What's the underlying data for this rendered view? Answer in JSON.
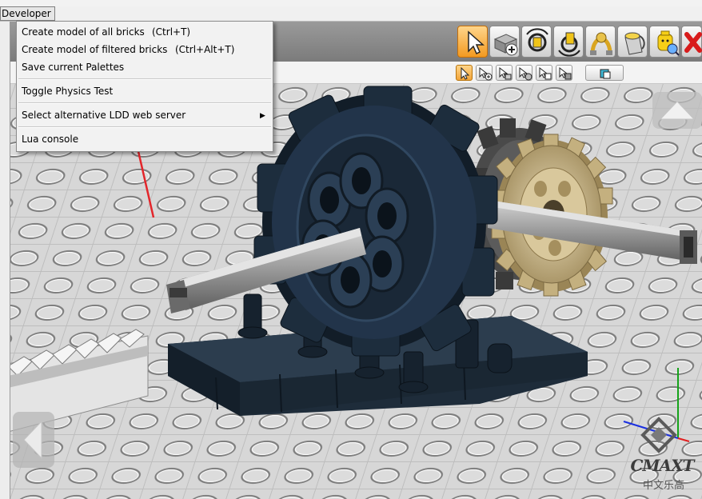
{
  "menubar": {
    "developer_label": "Developer"
  },
  "dropdown": {
    "items": [
      {
        "label": "Create model of all bricks",
        "shortcut": "(Ctrl+T)"
      },
      {
        "label": "Create model of filtered bricks",
        "shortcut": "(Ctrl+Alt+T)"
      },
      {
        "label": "Save current Palettes",
        "shortcut": ""
      },
      {
        "label": "Toggle Physics Test",
        "shortcut": ""
      },
      {
        "label": "Select alternative LDD web server",
        "shortcut": ""
      },
      {
        "label": "Lua console",
        "shortcut": ""
      }
    ]
  },
  "toolbar": {
    "tools": [
      "select-tool",
      "clone-tool",
      "hinge-tool",
      "hinge-align-tool",
      "flex-tool",
      "paint-tool",
      "decoration-tool",
      "delete-tool"
    ],
    "active_tool": "select-tool",
    "subtools": [
      "single-select",
      "multi-select",
      "connected-select",
      "same-color-select",
      "same-shape-select",
      "same-color-shape-select",
      "invert-select"
    ]
  },
  "watermark": {
    "latin": "CMAXT",
    "cjk": "中文乐高"
  },
  "colors": {
    "annotation_arrow": "#e3262b",
    "active_tool": "#f29a21",
    "gear_dark": "#1b2a38",
    "gear_tan": "#c9b68a",
    "axle_grey": "#9c9c9c",
    "baseplate": "#d6d6d6"
  }
}
